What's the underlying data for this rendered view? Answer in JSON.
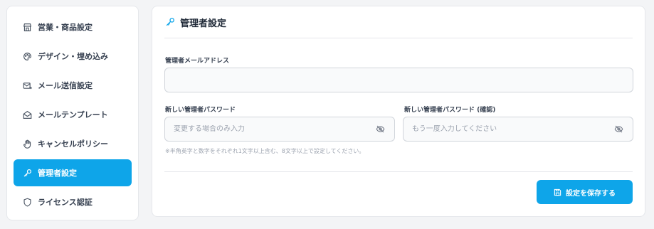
{
  "sidebar": {
    "items": [
      {
        "label": "営業・商品設定",
        "icon": "store-icon",
        "active": false
      },
      {
        "label": "デザイン・埋め込み",
        "icon": "palette-icon",
        "active": false
      },
      {
        "label": "メール送信設定",
        "icon": "mail-send-icon",
        "active": false
      },
      {
        "label": "メールテンプレート",
        "icon": "mail-open-icon",
        "active": false
      },
      {
        "label": "キャンセルポリシー",
        "icon": "hand-icon",
        "active": false
      },
      {
        "label": "管理者設定",
        "icon": "key-icon",
        "active": true
      },
      {
        "label": "ライセンス認証",
        "icon": "shield-icon",
        "active": false
      }
    ]
  },
  "panel": {
    "title": "管理者設定",
    "email": {
      "label": "管理者メールアドレス",
      "value": ""
    },
    "new_password": {
      "label": "新しい管理者パスワード",
      "placeholder": "変更する場合のみ入力"
    },
    "confirm_password": {
      "label": "新しい管理者パスワード (確認)",
      "placeholder": "もう一度入力してください"
    },
    "hint": "※半角英字と数字をそれぞれ1文字以上含む、8文字以上で設定してください。",
    "save_label": "設定を保存する"
  },
  "colors": {
    "accent": "#0ea5e9",
    "background": "#f3f4f6",
    "card": "#ffffff",
    "border": "#e5e7eb"
  }
}
